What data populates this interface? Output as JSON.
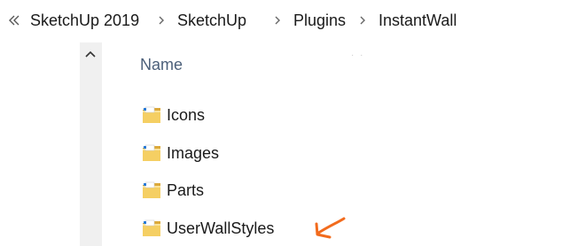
{
  "breadcrumb": {
    "overflow_icon": "double-chevron-left-icon",
    "items": [
      "SketchUp 2019",
      "SketchUp",
      "Plugins",
      "InstantWall"
    ],
    "separator_icon": "chevron-right-icon"
  },
  "list_header": {
    "name_label": "Name"
  },
  "scrollbar": {
    "up_icon": "chevron-up-icon"
  },
  "files": [
    {
      "name": "Icons",
      "icon": "folder-icon"
    },
    {
      "name": "Images",
      "icon": "folder-icon"
    },
    {
      "name": "Parts",
      "icon": "folder-icon"
    },
    {
      "name": "UserWallStyles",
      "icon": "folder-icon"
    }
  ],
  "annotation": {
    "icon": "hand-drawn-arrow-icon",
    "color": "#f26b1d"
  },
  "colors": {
    "folder": "#f5cf63",
    "folder_dark": "#dca93a",
    "header_text": "#4c607a"
  }
}
